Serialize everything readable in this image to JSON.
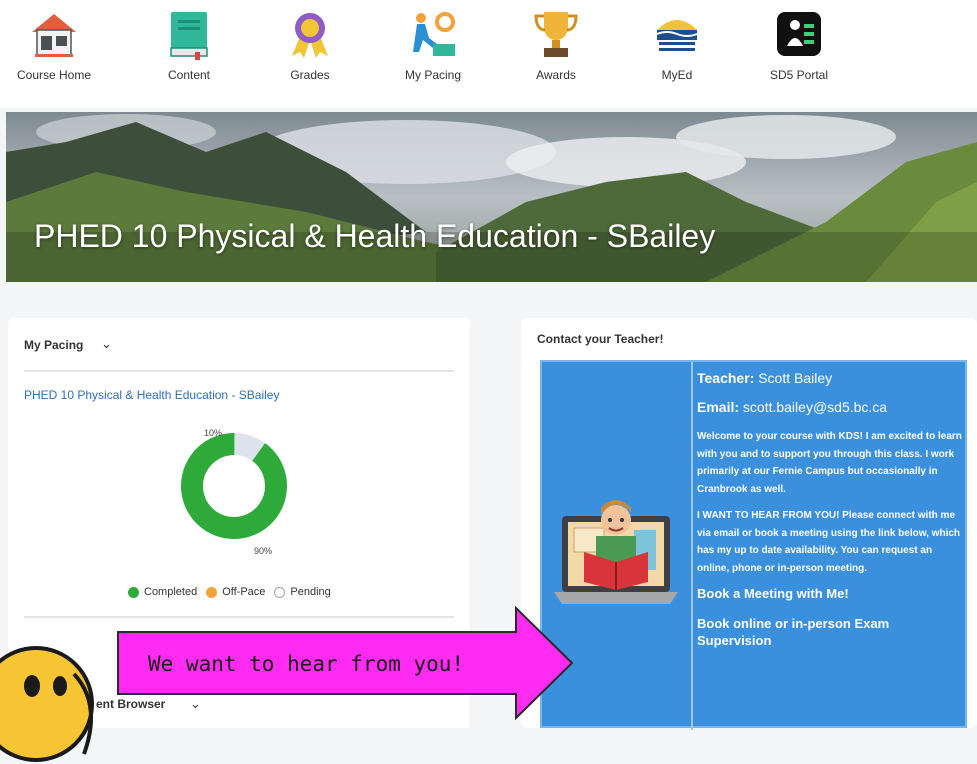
{
  "nav": {
    "items": [
      {
        "label": "Course Home",
        "icon": "house-icon"
      },
      {
        "label": "Content",
        "icon": "book-icon"
      },
      {
        "label": "Grades",
        "icon": "ribbon-award-icon"
      },
      {
        "label": "My Pacing",
        "icon": "pacing-gears-icon"
      },
      {
        "label": "Awards",
        "icon": "trophy-icon"
      },
      {
        "label": "MyEd",
        "icon": "bc-logo-icon"
      },
      {
        "label": "SD5 Portal",
        "icon": "portal-icon"
      }
    ]
  },
  "banner": {
    "title": "PHED 10 Physical & Health Education - SBailey"
  },
  "pacing": {
    "title": "My Pacing",
    "course_link": "PHED 10 Physical & Health Education - SBailey",
    "pending_label": "10%",
    "completed_label": "90%",
    "completed_fraction": 0.9,
    "legend": [
      {
        "label": "Completed",
        "color": "#2eaa3a"
      },
      {
        "label": "Off-Pace",
        "color": "#f3a33a"
      },
      {
        "label": "Pending",
        "color": "#dde3ee"
      }
    ]
  },
  "browser": {
    "label": "ent Browser"
  },
  "contact": {
    "title": "Contact your Teacher!",
    "teacher_key": "Teacher:",
    "teacher_val": " Scott Bailey",
    "email_key": "Email:",
    "email_val": " scott.bailey@sd5.bc.ca",
    "welcome": "Welcome to your course with KDS! I am excited to learn with you and to support you through this class. I work primarily at our Fernie Campus but occasionally in Cranbrook as well.",
    "hear": "I WANT TO HEAR FROM YOU! Please connect with me via email or book a meeting using the link below, which has my up to date availability. You can request an online, phone or in-person meeting.",
    "book_meeting": "Book a Meeting with Me!",
    "book_exam": "Book online or in-person Exam Supervision"
  },
  "callout": {
    "text": "We want to hear from you!",
    "color": "#ff2bf2"
  }
}
